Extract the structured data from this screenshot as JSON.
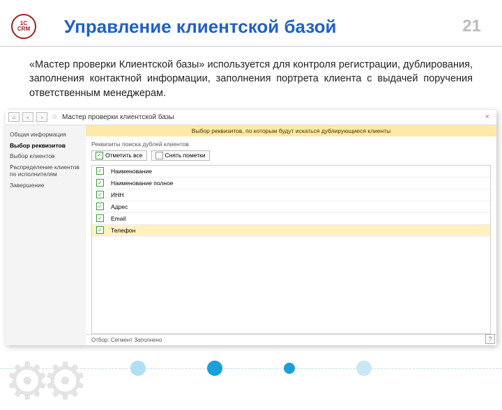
{
  "header": {
    "logo_top": "1C",
    "logo_bottom": "CRM",
    "title": "Управление клиентской базой",
    "page_number": "21"
  },
  "intro": "«Мастер проверки Клиентской базы» используется для контроля регистрации, дублирования, заполнения контактной информации, заполнения портрета клиента с выдачей поручения ответственным менеджерам.",
  "app": {
    "toolbar": {
      "home_icon": "⌂",
      "left_icon": "‹",
      "right_icon": "›",
      "star_icon": "☆",
      "title": "Мастер проверки клиентской базы",
      "close_icon": "×"
    },
    "sidebar": {
      "items": [
        "Общая информация",
        "Выбор реквизитов",
        "Выбор клиентов",
        "Распределение клиентов по исполнителям",
        "Завершение"
      ],
      "active_index": 1
    },
    "main": {
      "instruction": "Выбор реквизитов, по которым будут искаться дублирующиеся клиенты",
      "section_label": "Реквизиты поиска дублей клиентов",
      "actions": {
        "check_all": "Отметить все",
        "uncheck_all": "Снять пометки"
      },
      "rows": [
        {
          "label": "Наименование",
          "checked": true
        },
        {
          "label": "Наименование полное",
          "checked": true
        },
        {
          "label": "ИНН",
          "checked": true
        },
        {
          "label": "Адрес",
          "checked": true
        },
        {
          "label": "Email",
          "checked": true
        },
        {
          "label": "Телефон",
          "checked": true
        }
      ],
      "selected_row_index": 5,
      "status": "Отбор: Сегмент Заполнено",
      "help_icon": "?"
    }
  }
}
